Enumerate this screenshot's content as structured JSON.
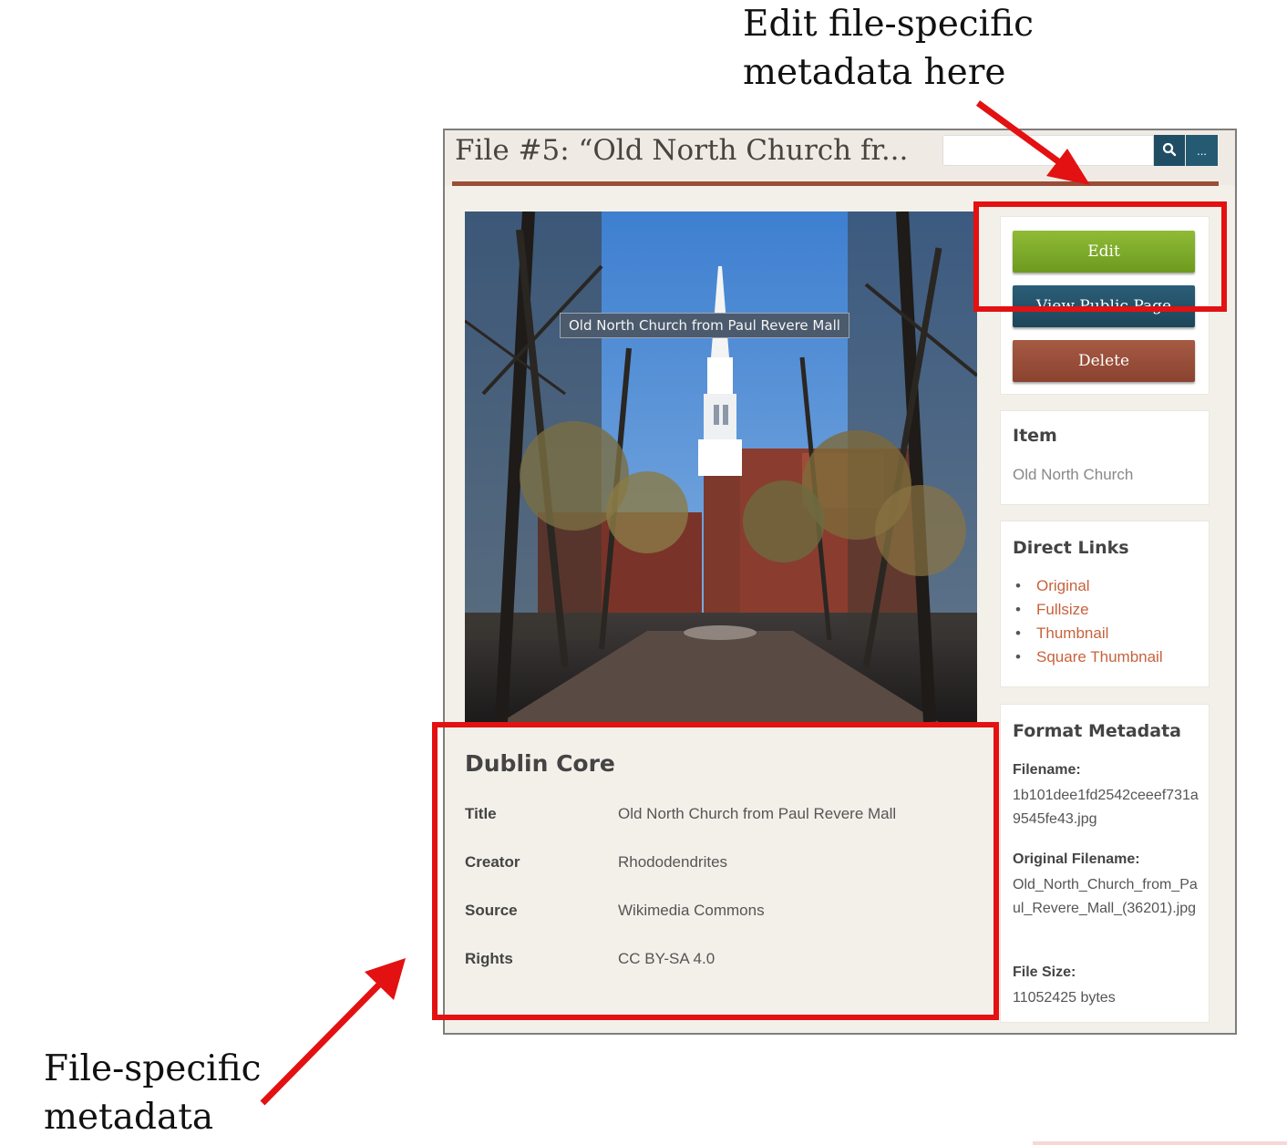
{
  "annotations": {
    "top_lines": [
      "Edit file-specific",
      "metadata here"
    ],
    "bottom_lines": [
      "File-specific",
      "metadata"
    ]
  },
  "header": {
    "title": "File #5: “Old North Church fr...",
    "search_placeholder": "",
    "search_icon": "search-icon",
    "more_label": "..."
  },
  "image": {
    "caption": "Old North Church from Paul Revere Mall"
  },
  "dublin_core": {
    "heading": "Dublin Core",
    "rows": [
      {
        "label": "Title",
        "value": "Old North Church from Paul Revere Mall"
      },
      {
        "label": "Creator",
        "value": "Rhododendrites"
      },
      {
        "label": "Source",
        "value": "Wikimedia Commons"
      },
      {
        "label": "Rights",
        "value": "CC BY-SA 4.0"
      }
    ]
  },
  "actions": {
    "edit": "Edit",
    "view_public": "View Public Page",
    "delete": "Delete"
  },
  "item": {
    "heading": "Item",
    "value": "Old North Church"
  },
  "direct_links": {
    "heading": "Direct Links",
    "links": [
      "Original",
      "Fullsize",
      "Thumbnail",
      "Square Thumbnail"
    ]
  },
  "format_metadata": {
    "heading": "Format Metadata",
    "filename_label": "Filename:",
    "filename": "1b101dee1fd2542ceeef731a9545fe43.jpg",
    "original_label": "Original Filename:",
    "original": "Old_North_Church_from_Paul_Revere_Mall_(36201).jpg",
    "size_label": "File Size:",
    "size": "11052425 bytes"
  },
  "colors": {
    "accent_rule": "#9a4d37",
    "edit_button": "#7aa82a",
    "public_button": "#1e4559",
    "delete_button": "#9a4d37",
    "link": "#c8623c",
    "highlight": "#e31111"
  }
}
